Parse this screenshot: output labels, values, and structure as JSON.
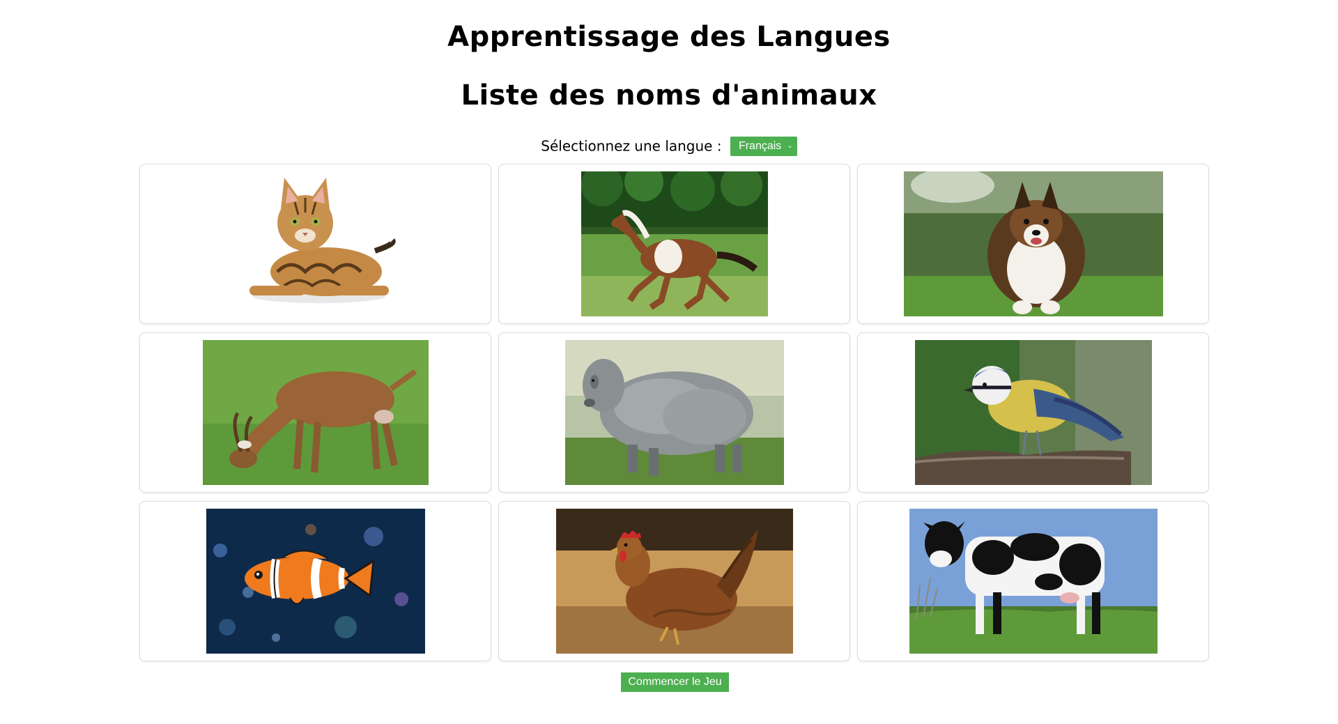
{
  "header": {
    "title": "Apprentissage des Langues",
    "subtitle": "Liste des noms d'animaux"
  },
  "language": {
    "label": "Sélectionnez une langue :",
    "selected": "Français",
    "accent_color": "#4caf50"
  },
  "animals": [
    {
      "icon": "cat-image"
    },
    {
      "icon": "horse-image"
    },
    {
      "icon": "dog-image"
    },
    {
      "icon": "goat-image"
    },
    {
      "icon": "sheep-image"
    },
    {
      "icon": "bird-image"
    },
    {
      "icon": "fish-image"
    },
    {
      "icon": "chicken-image"
    },
    {
      "icon": "cow-image"
    }
  ],
  "actions": {
    "start_label": "Commencer le Jeu"
  }
}
